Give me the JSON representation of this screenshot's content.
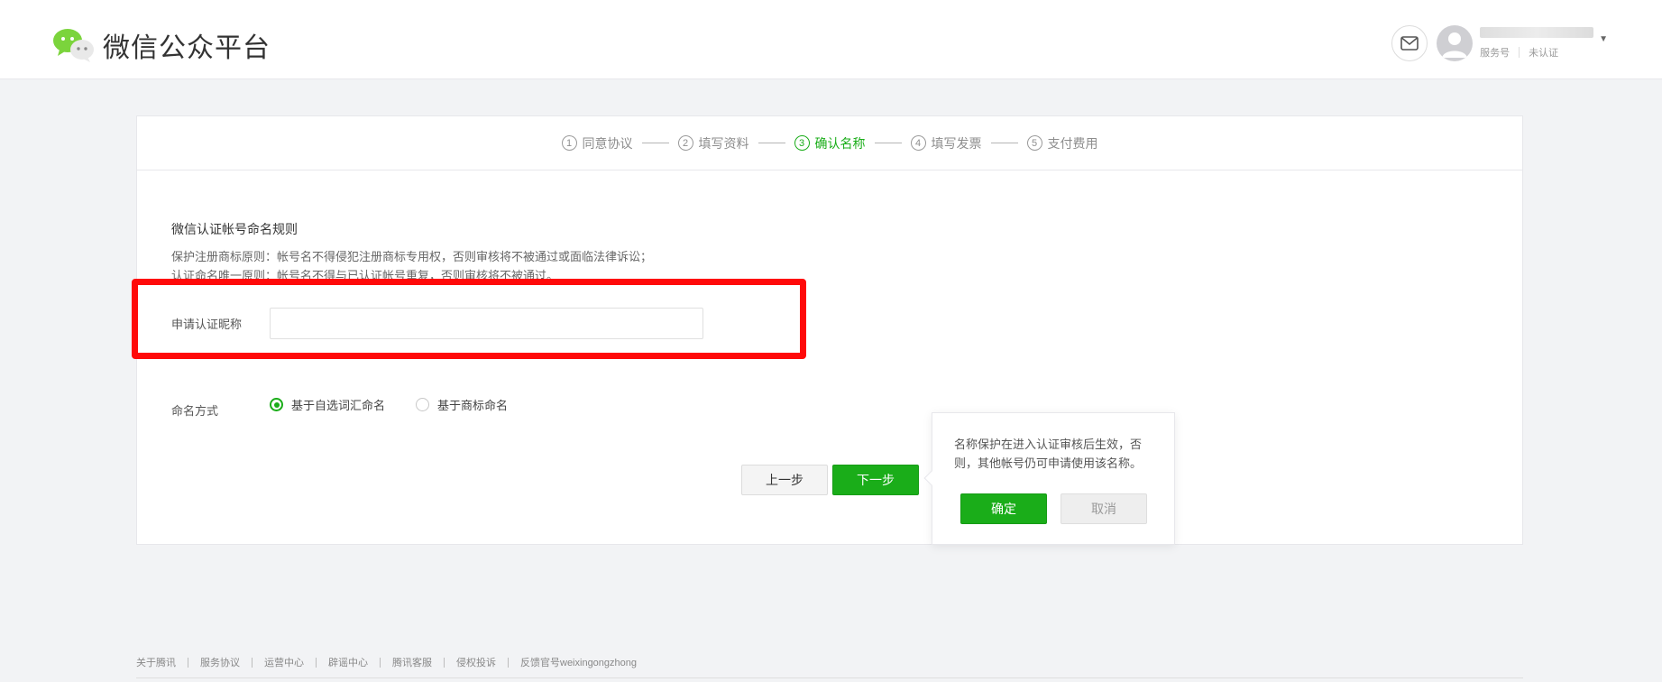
{
  "app": {
    "title": "微信公众平台"
  },
  "header": {
    "account_type": "服务号",
    "verify_status": "未认证"
  },
  "steps": [
    {
      "num": "1",
      "label": "同意协议"
    },
    {
      "num": "2",
      "label": "填写资料"
    },
    {
      "num": "3",
      "label": "确认名称"
    },
    {
      "num": "4",
      "label": "填写发票"
    },
    {
      "num": "5",
      "label": "支付费用"
    }
  ],
  "rules": {
    "title": "微信认证帐号命名规则",
    "line1": "保护注册商标原则：帐号名不得侵犯注册商标专用权，否则审核将不被通过或面临法律诉讼；",
    "line2": "认证命名唯一原则：帐号名不得与已认证帐号重复，否则审核将不被通过。"
  },
  "form": {
    "nickname_label": "申请认证昵称",
    "nickname_value": "",
    "naming_label": "命名方式",
    "naming_options": [
      {
        "label": "基于自选词汇命名",
        "checked": true
      },
      {
        "label": "基于商标命名",
        "checked": false
      }
    ]
  },
  "buttons": {
    "prev": "上一步",
    "next": "下一步"
  },
  "popover": {
    "text": "名称保护在进入认证审核后生效，否则，其他帐号仍可申请使用该名称。",
    "confirm": "确定",
    "cancel": "取消"
  },
  "footer": {
    "links": [
      "关于腾讯",
      "服务协议",
      "运营中心",
      "辟谣中心",
      "腾讯客服",
      "侵权投诉",
      "反馈官号weixingongzhong"
    ]
  },
  "colors": {
    "brand_green": "#1aad19",
    "highlight_red": "#ff0a0a"
  }
}
